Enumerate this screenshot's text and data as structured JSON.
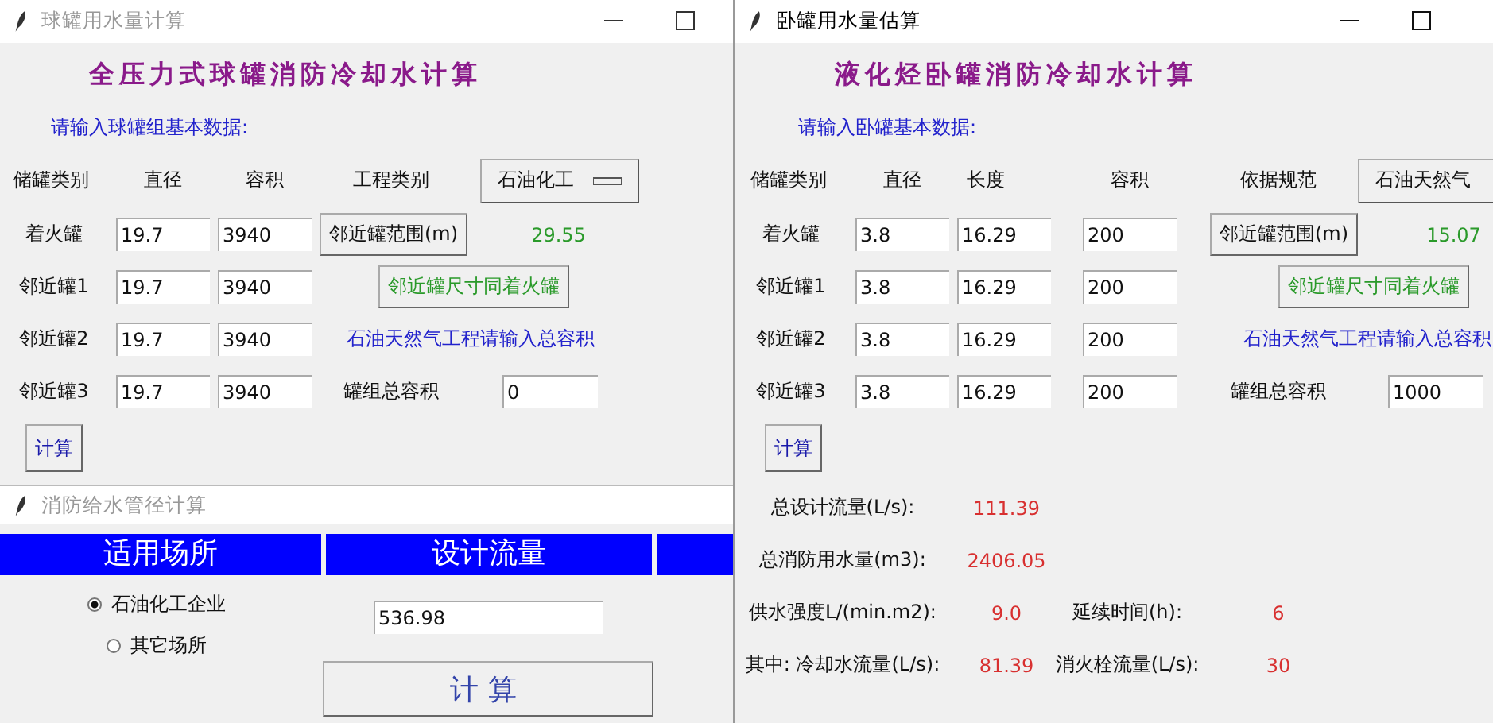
{
  "sphere_window": {
    "title": "球罐用水量计算",
    "active": false,
    "heading": "全压力式球罐消防冷却水计算",
    "prompt": "请输入球罐组基本数据:",
    "columns": [
      "储罐类别",
      "直径",
      "容积",
      "工程类别"
    ],
    "dropdown": "石油化工",
    "rows": [
      {
        "label": "着火罐",
        "diameter": "19.7",
        "volume": "3940"
      },
      {
        "label": "邻近罐1",
        "diameter": "19.7",
        "volume": "3940"
      },
      {
        "label": "邻近罐2",
        "diameter": "19.7",
        "volume": "3940"
      },
      {
        "label": "邻近罐3",
        "diameter": "19.7",
        "volume": "3940"
      }
    ],
    "range_button": "邻近罐范围(m)",
    "range_value": "29.55",
    "same_size_button": "邻近罐尺寸同着火罐",
    "note": "石油天然气工程请输入总容积",
    "total_label": "罐组总容积",
    "total_value": "0",
    "calc_button": "计算"
  },
  "horizontal_window": {
    "title": "卧罐用水量估算",
    "active": true,
    "heading": "液化烃卧罐消防冷却水计算",
    "prompt": "请输入卧罐基本数据:",
    "columns": [
      "储罐类别",
      "直径",
      "长度",
      "容积",
      "依据规范"
    ],
    "dropdown": "石油天然气",
    "rows": [
      {
        "label": "着火罐",
        "diameter": "3.8",
        "length": "16.29",
        "volume": "200"
      },
      {
        "label": "邻近罐1",
        "diameter": "3.8",
        "length": "16.29",
        "volume": "200"
      },
      {
        "label": "邻近罐2",
        "diameter": "3.8",
        "length": "16.29",
        "volume": "200"
      },
      {
        "label": "邻近罐3",
        "diameter": "3.8",
        "length": "16.29",
        "volume": "200"
      }
    ],
    "range_button": "邻近罐范围(m)",
    "range_value": "15.07",
    "same_size_button": "邻近罐尺寸同着火罐",
    "note": "石油天然气工程请输入总容积",
    "total_label": "罐组总容积",
    "total_value": "1000",
    "calc_button": "计算",
    "results": [
      [
        {
          "label": "总设计流量(L/s):",
          "value": "111.39"
        }
      ],
      [
        {
          "label": "总消防用水量(m3):",
          "value": "2406.05"
        }
      ],
      [
        {
          "label": "供水强度L/(min.m2):",
          "value": "9.0"
        },
        {
          "label": "延续时间(h):",
          "value": "6"
        }
      ],
      [
        {
          "label": "其中: 冷却水流量(L/s):",
          "value": "81.39"
        },
        {
          "label": "消火栓流量(L/s):",
          "value": "30"
        }
      ]
    ]
  },
  "pipe_window": {
    "title": "消防给水管径计算",
    "active": false,
    "headers": [
      "适用场所",
      "设计流量"
    ],
    "options": [
      {
        "label": "石油化工企业",
        "selected": true
      },
      {
        "label": "其它场所",
        "selected": false
      }
    ],
    "flow_value": "536.98",
    "calc_button": "计算"
  }
}
